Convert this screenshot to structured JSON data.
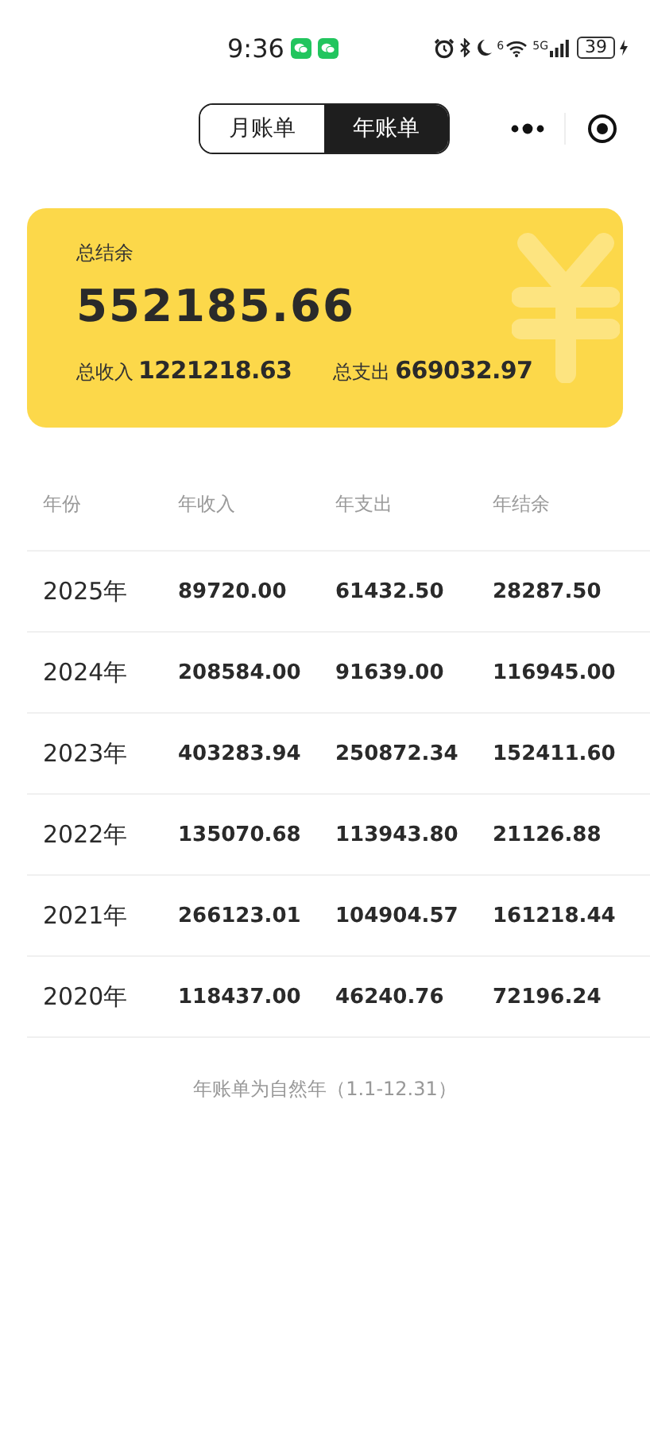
{
  "status_bar": {
    "time": "9:36",
    "wifi_badge": "6",
    "network": "5G",
    "battery": "39"
  },
  "tabs": [
    {
      "label": "月账单",
      "selected": false
    },
    {
      "label": "年账单",
      "selected": true
    }
  ],
  "summary": {
    "balance_label": "总结余",
    "balance": "552185.66",
    "income_label": "总收入",
    "income": "1221218.63",
    "expense_label": "总支出",
    "expense": "669032.97"
  },
  "table": {
    "columns": [
      "年份",
      "年收入",
      "年支出",
      "年结余"
    ],
    "rows": [
      [
        "2025年",
        "89720.00",
        "61432.50",
        "28287.50"
      ],
      [
        "2024年",
        "208584.00",
        "91639.00",
        "116945.00"
      ],
      [
        "2023年",
        "403283.94",
        "250872.34",
        "152411.60"
      ],
      [
        "2022年",
        "135070.68",
        "113943.80",
        "21126.88"
      ],
      [
        "2021年",
        "266123.01",
        "104904.57",
        "161218.44"
      ],
      [
        "2020年",
        "118437.00",
        "46240.76",
        "72196.24"
      ]
    ]
  },
  "footnote": "年账单为自然年（1.1-12.31）"
}
